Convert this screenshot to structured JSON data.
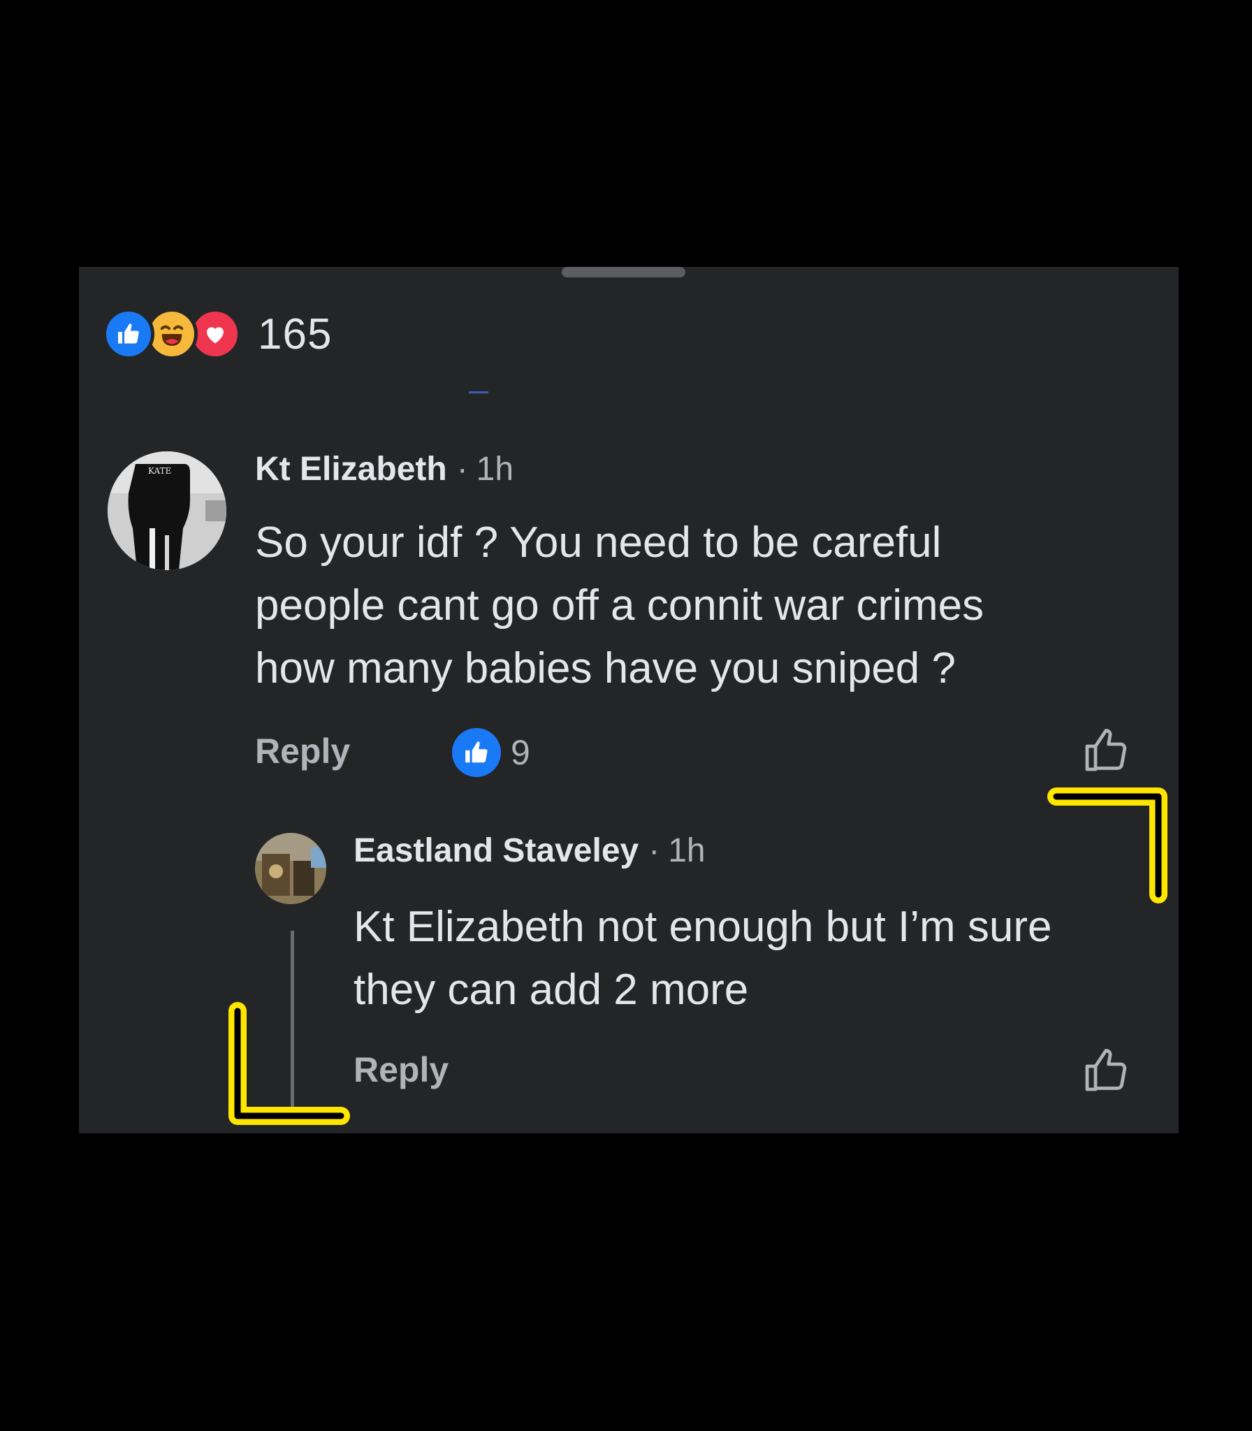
{
  "post": {
    "reactions": {
      "icons": [
        "like-icon",
        "haha-icon",
        "love-icon"
      ],
      "count": "165"
    }
  },
  "comments": [
    {
      "author": "Kt Elizabeth",
      "separator": "·",
      "time": "1h",
      "avatar_text": "KATE",
      "body_lines": [
        "So your idf ? You need to be careful",
        "people cant go off a connit war crimes",
        "how many babies have you sniped ?"
      ],
      "reply_label": "Reply",
      "like_count": "9"
    },
    {
      "author": "Eastland Staveley",
      "separator": "·",
      "time": "1h",
      "body_lines": [
        "Kt Elizabeth not enough but I’m sure",
        "they can add 2 more"
      ],
      "reply_label": "Reply"
    }
  ],
  "colors": {
    "background": "#000000",
    "panel": "#242526",
    "primary_text": "#e4e6eb",
    "secondary_text": "#b0b3b8",
    "like_blue": "#1a7af6",
    "haha_yellow": "#f6b93b",
    "love_red": "#f0354f",
    "highlight_yellow": "#ffe600"
  }
}
